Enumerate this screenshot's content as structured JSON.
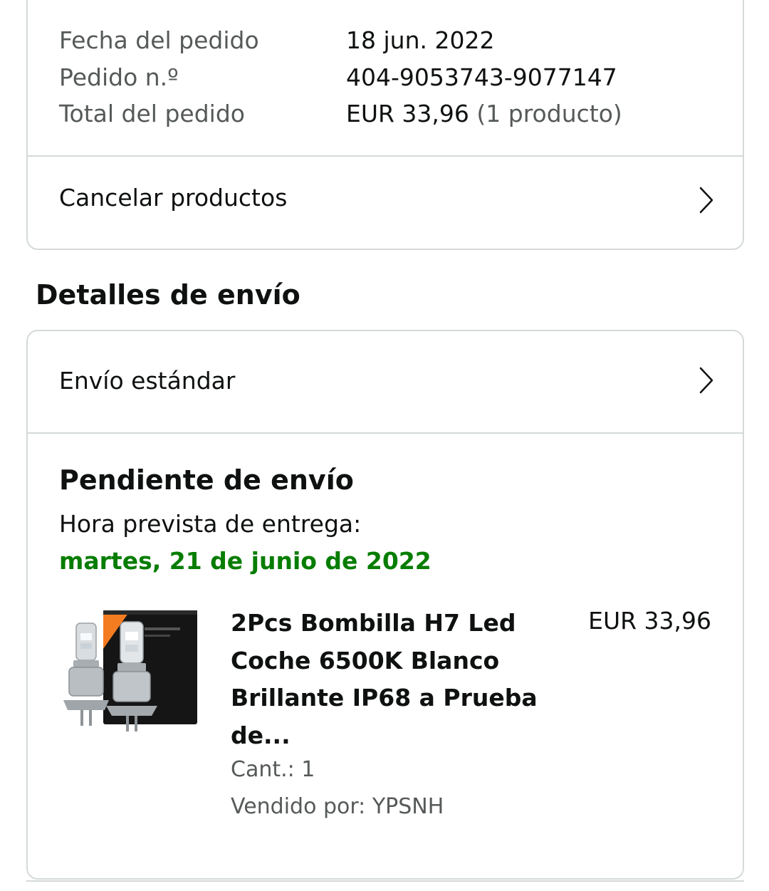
{
  "order_summary": {
    "rows": [
      {
        "label": "Fecha del pedido",
        "value": "18 jun. 2022",
        "extra": ""
      },
      {
        "label": "Pedido n.º",
        "value": "404-9053743-9077147",
        "extra": ""
      },
      {
        "label": "Total del pedido",
        "value": "EUR 33,96",
        "extra": "(1 producto)"
      }
    ],
    "cancel_label": "Cancelar productos"
  },
  "shipping": {
    "section_title": "Detalles de envío",
    "method_label": "Envío estándar",
    "status_title": "Pendiente de envío",
    "delivery_label": "Hora prevista de entrega:",
    "delivery_date": "martes, 21 de junio de 2022",
    "delivery_date_color": "#067d00"
  },
  "product": {
    "title": "2Pcs Bombilla H7 Led Coche 6500K Blanco Brillante IP68 a Prueba de...",
    "price": "EUR 33,96",
    "quantity": "Cant.: 1",
    "seller": "Vendido por: YPSNH",
    "image_icon": "led-bulb-product-image"
  },
  "icons": {
    "chevron": "chevron-right-icon"
  },
  "colors": {
    "border": "#d5d9d9",
    "muted_text": "#565959",
    "primary_text": "#0f1111",
    "accent_orange": "#f47c20"
  }
}
